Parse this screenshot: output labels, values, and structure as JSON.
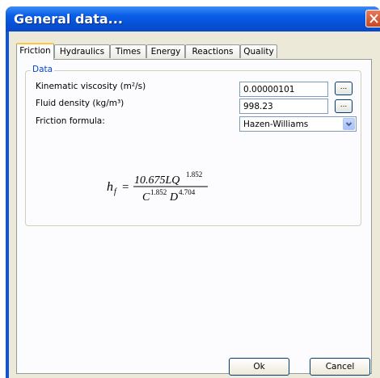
{
  "window": {
    "title": "General data..."
  },
  "tabs": [
    "Friction",
    "Hydraulics",
    "Times",
    "Energy",
    "Reactions",
    "Quality"
  ],
  "active_tab": "Friction",
  "group": {
    "label": "Data",
    "kinematic_viscosity_label": "Kinematic viscosity (m²/s)",
    "kinematic_viscosity_value": "0.00000101",
    "fluid_density_label": "Fluid density (kg/m³)",
    "fluid_density_value": "998.23",
    "friction_formula_label": "Friction formula:",
    "friction_formula_value": "Hazen-Williams",
    "browse_label": "..."
  },
  "formula": {
    "lhs": "h",
    "lhs_sub": "f",
    "equals": "=",
    "num_coef": "10.675LQ",
    "num_exp": "1.852",
    "den_c": "C",
    "den_c_exp": "1.852",
    "den_d": "D",
    "den_d_exp": "4.704"
  },
  "buttons": {
    "ok": "Ok",
    "cancel": "Cancel"
  }
}
